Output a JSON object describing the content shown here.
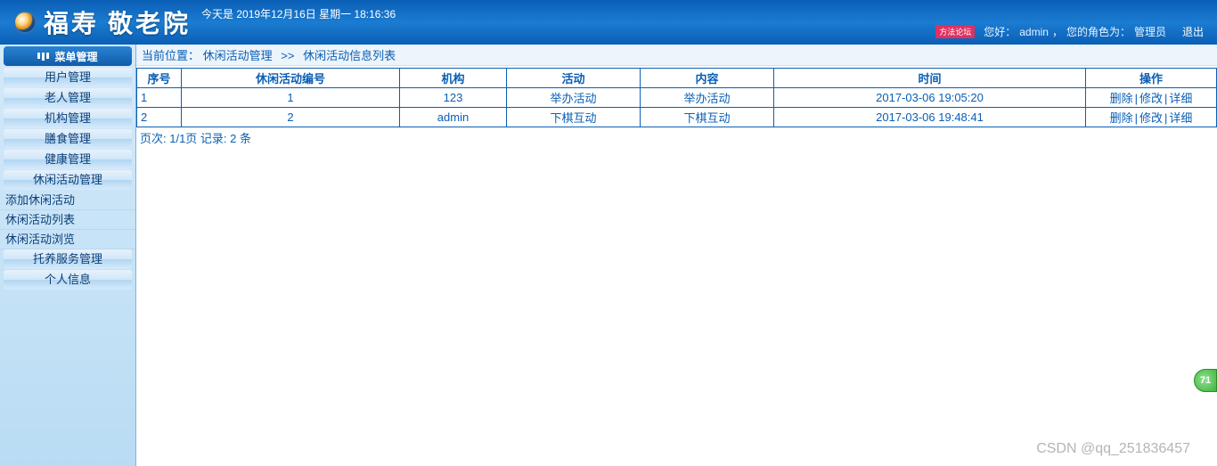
{
  "header": {
    "title": "福寿 敬老院",
    "today_prefix": "今天是",
    "today_date": "2019年12月16日 星期一 18:16:36",
    "hello_prefix": "您好：",
    "hello_user": "admin",
    "role_prefix": "您的角色为：",
    "role": "管理员",
    "logout": "退出",
    "notice": "方法论坛"
  },
  "sidebar": {
    "title": "菜单管理",
    "items": [
      {
        "label": "用户管理"
      },
      {
        "label": "老人管理"
      },
      {
        "label": "机构管理"
      },
      {
        "label": "膳食管理"
      },
      {
        "label": "健康管理"
      },
      {
        "label": "休闲活动管理"
      }
    ],
    "subitems": [
      {
        "label": "添加休闲活动"
      },
      {
        "label": "休闲活动列表"
      },
      {
        "label": "休闲活动浏览"
      }
    ],
    "tail_items": [
      {
        "label": "托养服务管理"
      },
      {
        "label": "个人信息"
      }
    ]
  },
  "breadcrumb": {
    "label": "当前位置：",
    "part1": "休闲活动管理",
    "sep": ">>",
    "part2": "休闲活动信息列表"
  },
  "table": {
    "headers": [
      "序号",
      "休闲活动编号",
      "机构",
      "活动",
      "内容",
      "时间",
      "操作"
    ],
    "rows": [
      {
        "seq": "1",
        "id": "1",
        "org": "123",
        "activity": "举办活动",
        "content": "举办活动",
        "time": "2017-03-06 19:05:20"
      },
      {
        "seq": "2",
        "id": "2",
        "org": "admin",
        "activity": "下棋互动",
        "content": "下棋互动",
        "time": "2017-03-06 19:48:41"
      }
    ],
    "ops": {
      "delete": "删除",
      "edit": "修改",
      "detail": "详细"
    }
  },
  "pager": {
    "text": "页次: 1/1页 记录: 2 条"
  },
  "watermark": "CSDN @qq_251836457",
  "float_badge": "71"
}
